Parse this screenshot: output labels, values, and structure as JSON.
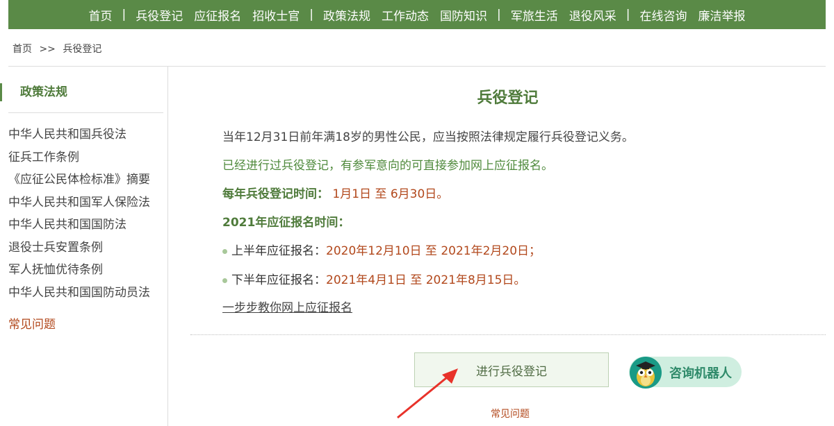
{
  "nav": {
    "items": [
      "首页",
      "兵役登记",
      "应征报名",
      "招收士官",
      "政策法规",
      "工作动态",
      "国防知识",
      "军旅生活",
      "退役风采",
      "在线咨询",
      "廉洁举报"
    ],
    "separator": "|"
  },
  "breadcrumb": {
    "home": "首页",
    "sep": ">>",
    "current": "兵役登记"
  },
  "sidebar": {
    "title": "政策法规",
    "links": [
      "中华人民共和国兵役法",
      "征兵工作条例",
      "《应征公民体检标准》摘要",
      "中华人民共和国军人保险法",
      "中华人民共和国国防法",
      "退役士兵安置条例",
      "军人抚恤优待条例",
      "中华人民共和国国防动员法"
    ],
    "faq": "常见问题"
  },
  "main": {
    "title": "兵役登记",
    "line1": "当年12月31日前年满18岁的男性公民，应当按照法律规定履行兵役登记义务。",
    "line2": "已经进行过兵役登记，有参军意向的可直接参加网上应征报名。",
    "reg_time_label": "每年兵役登记时间：",
    "reg_time_value": "1月1日 至 6月30日。",
    "enlist_heading": "2021年应征报名时间：",
    "first_half_label": "上半年应征报名：",
    "first_half_value": "2020年12月10日 至 2021年2月20日；",
    "second_half_label": "下半年应征报名：",
    "second_half_value": "2021年4月1日 至 2021年8月15日。",
    "guide_link": "一步步教你网上应征报名",
    "register_button": "进行兵役登记",
    "robot_label": "咨询机器人",
    "faq": "常见问题"
  },
  "colors": {
    "nav_bg": "#5a8a47",
    "accent_green": "#4f7b3b",
    "accent_red": "#b2481c",
    "robot_bg": "#cfeee0"
  },
  "icons": {
    "robot": "robot-owl-avatar-icon",
    "arrow": "red-pointer-arrow-icon"
  }
}
